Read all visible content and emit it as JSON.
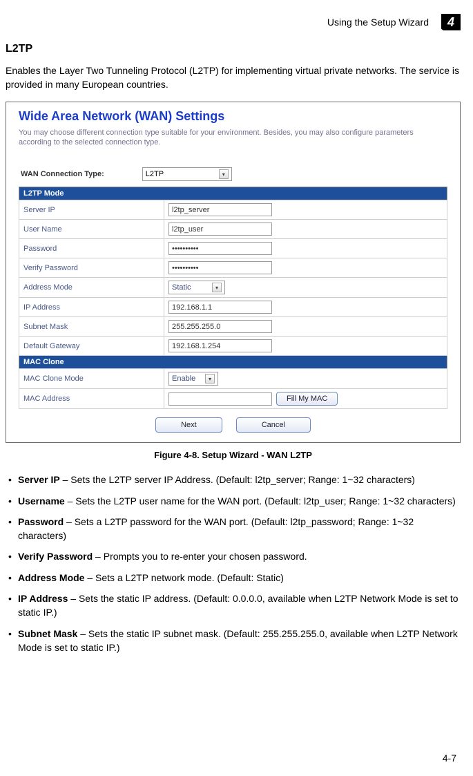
{
  "header": {
    "running_head": "Using the Setup Wizard",
    "chapter_number": "4"
  },
  "section": {
    "title": "L2TP",
    "description": "Enables the Layer Two Tunneling Protocol (L2TP) for implementing virtual private networks. The service is provided in many European countries."
  },
  "screenshot": {
    "title": "Wide Area Network (WAN) Settings",
    "subtitle": "You may choose different connection type suitable for your environment. Besides, you may also configure parameters according to the selected connection type.",
    "conn_type_label": "WAN Connection Type:",
    "conn_type_value": "L2TP",
    "section_l2tp": "L2TP Mode",
    "fields": {
      "server_ip_label": "Server IP",
      "server_ip_value": "l2tp_server",
      "user_name_label": "User Name",
      "user_name_value": "l2tp_user",
      "password_label": "Password",
      "password_value": "••••••••••",
      "verify_password_label": "Verify Password",
      "verify_password_value": "••••••••••",
      "address_mode_label": "Address Mode",
      "address_mode_value": "Static",
      "ip_address_label": "IP Address",
      "ip_address_value": "192.168.1.1",
      "subnet_mask_label": "Subnet Mask",
      "subnet_mask_value": "255.255.255.0",
      "default_gateway_label": "Default Gateway",
      "default_gateway_value": "192.168.1.254"
    },
    "section_mac": "MAC Clone",
    "mac_fields": {
      "mac_clone_mode_label": "MAC Clone Mode",
      "mac_clone_mode_value": "Enable",
      "mac_address_label": "MAC Address",
      "mac_address_value": "",
      "fill_my_mac": "Fill My MAC"
    },
    "buttons": {
      "next": "Next",
      "cancel": "Cancel"
    }
  },
  "figure_caption": "Figure 4-8.   Setup Wizard - WAN L2TP",
  "bullets": [
    {
      "bold": "Server IP",
      "text": " – Sets the L2TP server IP Address. (Default: l2tp_server; Range: 1~32 characters)"
    },
    {
      "bold": "Username",
      "text": " – Sets the L2TP user name for the WAN port. (Default: l2tp_user; Range: 1~32 characters)"
    },
    {
      "bold": "Password",
      "text": " – Sets a L2TP password for the WAN port. (Default: l2tp_password; Range: 1~32 characters)"
    },
    {
      "bold": "Verify Password",
      "text": " – Prompts you to re-enter your chosen password."
    },
    {
      "bold": "Address Mode",
      "text": " – Sets a L2TP network mode. (Default: Static)"
    },
    {
      "bold": "IP Address",
      "text": " – Sets the static IP address. (Default: 0.0.0.0, available when L2TP Network Mode is set to static IP.)"
    },
    {
      "bold": "Subnet Mask",
      "text": " – Sets the static IP subnet mask. (Default: 255.255.255.0, available when L2TP Network Mode is set to static IP.)"
    }
  ],
  "page_number": "4-7"
}
